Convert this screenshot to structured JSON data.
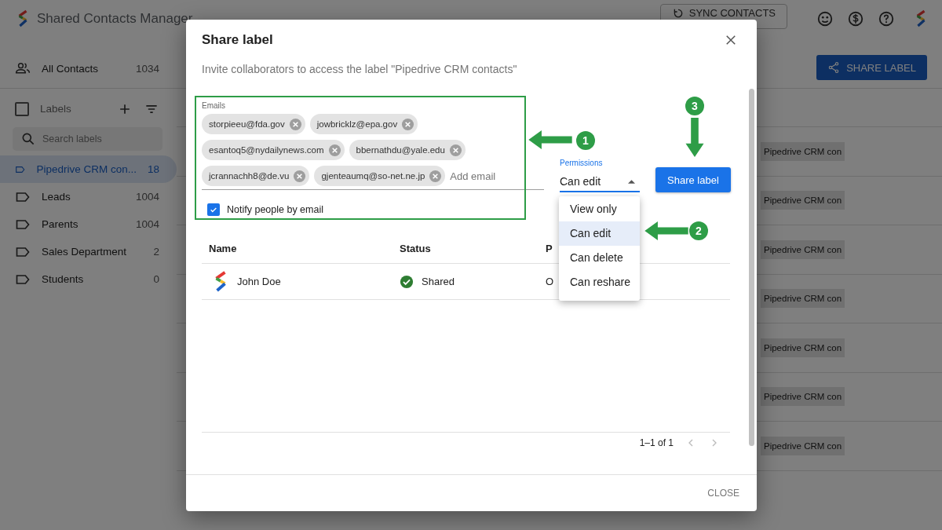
{
  "app": {
    "title": "Shared Contacts Manager",
    "sync_button": "SYNC CONTACTS",
    "share_button": "SHARE LABEL"
  },
  "sidebar": {
    "all_contacts": {
      "label": "All Contacts",
      "count": "1034"
    },
    "labels_heading": "Labels",
    "select_all_checked": false,
    "search_placeholder": "Search labels",
    "labels": [
      {
        "name": "Pipedrive CRM con...",
        "count": "18",
        "selected": true
      },
      {
        "name": "Leads",
        "count": "1004",
        "selected": false
      },
      {
        "name": "Parents",
        "count": "1004",
        "selected": false
      },
      {
        "name": "Sales Department",
        "count": "2",
        "selected": false
      },
      {
        "name": "Students",
        "count": "0",
        "selected": false
      }
    ]
  },
  "contact_rows": [
    {
      "label": "Pipedrive CRM con"
    },
    {
      "label": "Pipedrive CRM con"
    },
    {
      "label": "Pipedrive CRM con"
    },
    {
      "label": "Pipedrive CRM con"
    },
    {
      "label": "Pipedrive CRM con"
    },
    {
      "label": "Pipedrive CRM con"
    },
    {
      "label": "Pipedrive CRM con"
    }
  ],
  "dialog": {
    "title": "Share label",
    "subtitle": "Invite collaborators to access the label \"Pipedrive CRM contacts\"",
    "emails": {
      "label": "Emails",
      "chips": [
        "storpieeu@fda.gov",
        "jowbricklz@epa.gov",
        "esantoq5@nydailynews.com",
        "bbernathdu@yale.edu",
        "jcrannachh8@de.vu",
        "gjenteaumq@so-net.ne.jp"
      ],
      "placeholder": "Add email"
    },
    "notify": {
      "label": "Notify people by email",
      "checked": true
    },
    "permissions": {
      "label": "Permissions",
      "value": "Can edit",
      "options": [
        {
          "label": "View only",
          "selected": false
        },
        {
          "label": "Can edit",
          "selected": true
        },
        {
          "label": "Can delete",
          "selected": false
        },
        {
          "label": "Can reshare",
          "selected": false
        }
      ]
    },
    "share_button": "Share label",
    "table": {
      "columns": [
        "Name",
        "Status",
        "P"
      ],
      "rows": [
        {
          "name": "John Doe",
          "status": "Shared",
          "column_3": "O"
        }
      ]
    },
    "pagination": "1–1 of 1",
    "close_button": "CLOSE"
  },
  "annotations": [
    {
      "number": "1"
    },
    {
      "number": "2"
    },
    {
      "number": "3"
    }
  ]
}
